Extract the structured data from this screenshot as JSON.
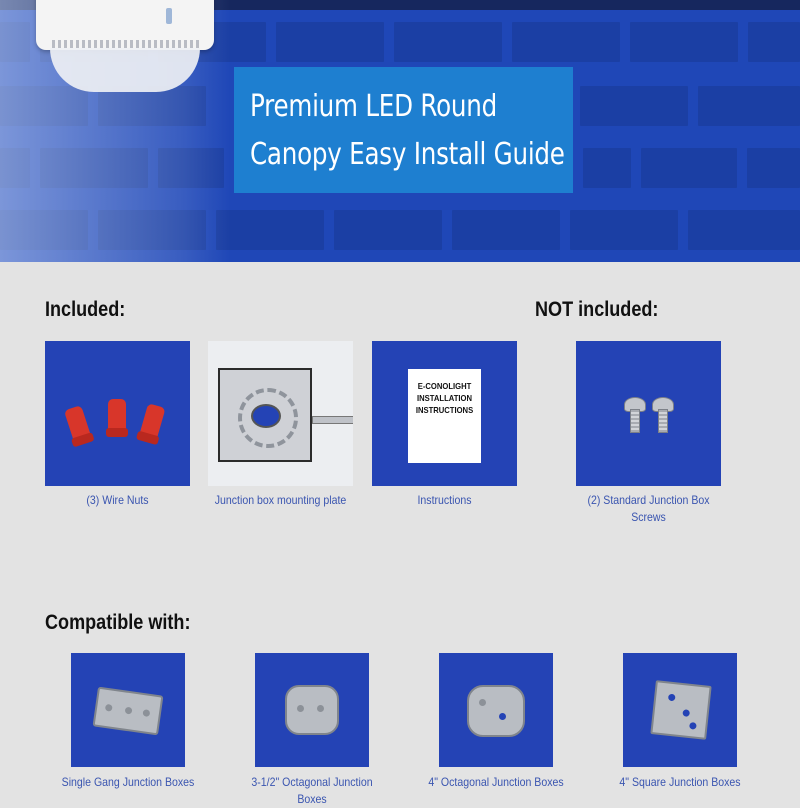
{
  "hero": {
    "title_line1": "Premium LED Round",
    "title_line2": "Canopy Easy Install Guide"
  },
  "included": {
    "heading": "Included:",
    "items": [
      {
        "caption": "(3) Wire Nuts",
        "icon": "wire-nuts-icon"
      },
      {
        "caption": "Junction box mounting plate",
        "icon": "mounting-plate-icon"
      },
      {
        "caption": "Instructions",
        "icon": "instructions-sheet-icon"
      }
    ],
    "instructions_sheet": {
      "line1": "E-CONOLIGHT",
      "line2": "INSTALLATION",
      "line3": "INSTRUCTIONS"
    }
  },
  "not_included": {
    "heading": "NOT included:",
    "items": [
      {
        "caption_line1": "(2) Standard Junction Box",
        "caption_line2": "Screws",
        "icon": "screws-icon"
      }
    ]
  },
  "compatible": {
    "heading": "Compatible with:",
    "items": [
      {
        "caption": "Single Gang Junction Boxes",
        "icon": "single-gang-box-icon"
      },
      {
        "caption": "3-1/2\" Octagonal Junction Boxes",
        "icon": "octagonal-box-icon"
      },
      {
        "caption": "4\" Octagonal Junction Boxes",
        "icon": "octagonal-box-icon"
      },
      {
        "caption": "4\" Square Junction Boxes",
        "icon": "square-box-icon"
      }
    ]
  },
  "colors": {
    "hero_blue": "#1f47b7",
    "title_box": "#1e7fd0",
    "tile_blue": "#2443b5",
    "caption_blue": "#3a55b0",
    "page_bg": "#e3e3e3"
  }
}
